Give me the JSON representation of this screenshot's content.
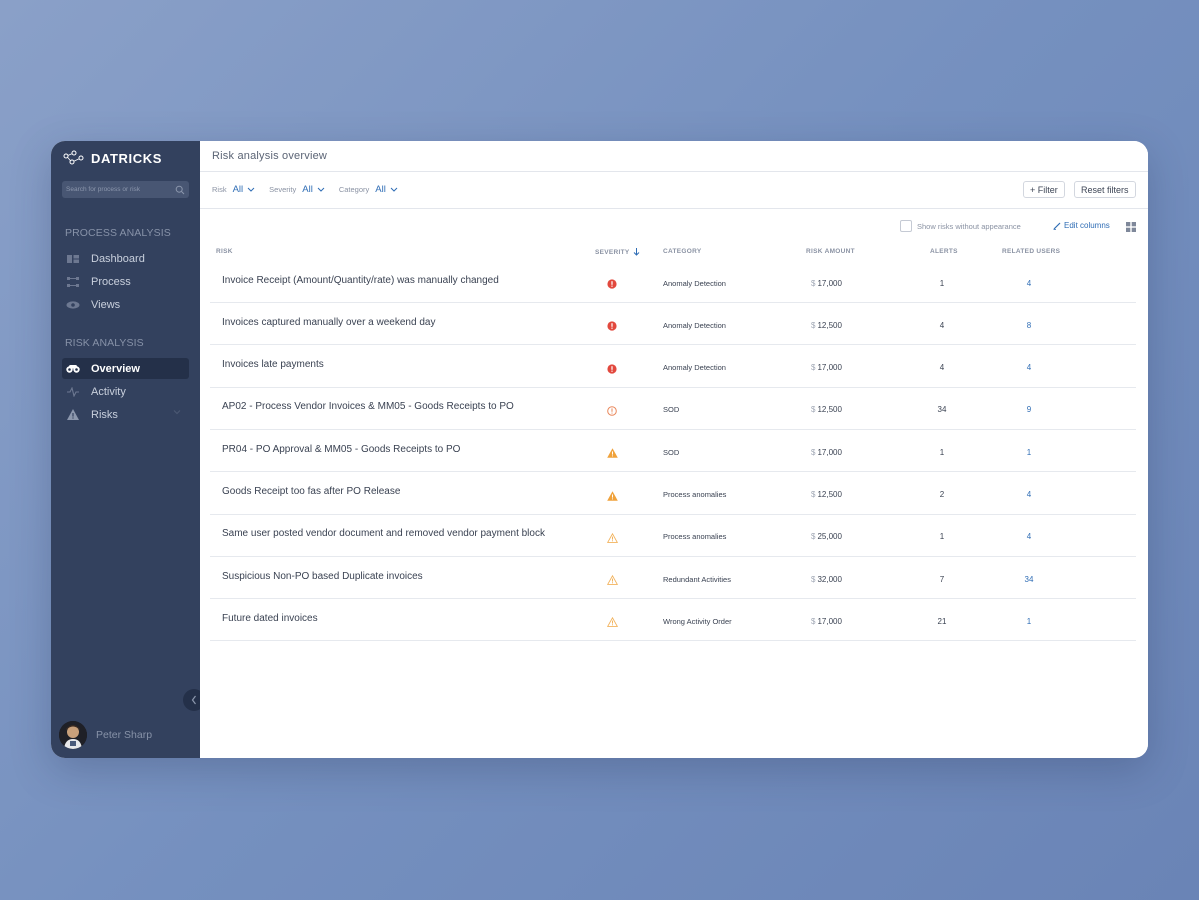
{
  "app": {
    "brand": "DATRICKS"
  },
  "sidebar": {
    "search_placeholder": "Search for process or risk",
    "sections": [
      {
        "title": "PROCESS ANALYSIS",
        "items": [
          {
            "label": "Dashboard",
            "icon": "dashboard-icon"
          },
          {
            "label": "Process",
            "icon": "process-icon"
          },
          {
            "label": "Views",
            "icon": "eye-icon"
          }
        ]
      },
      {
        "title": "RISK ANALYSIS",
        "items": [
          {
            "label": "Overview",
            "icon": "binoculars-icon",
            "active": true
          },
          {
            "label": "Activity",
            "icon": "activity-icon"
          },
          {
            "label": "Risks",
            "icon": "warning-icon",
            "expandable": true
          }
        ]
      }
    ],
    "user": {
      "name": "Peter Sharp"
    }
  },
  "main": {
    "title": "Risk analysis overview",
    "filters": [
      {
        "label": "Risk",
        "value": "All"
      },
      {
        "label": "Severity",
        "value": "All"
      },
      {
        "label": "Category",
        "value": "All"
      }
    ],
    "buttons": {
      "filter": "+  Filter",
      "reset": "Reset filters"
    },
    "show_without_appearance": "Show risks without appearance",
    "edit_columns": "Edit columns",
    "columns": {
      "risk": "RISK",
      "severity": "SEVERITY",
      "category": "CATEGORY",
      "amount": "RISK AMOUNT",
      "alerts": "ALERTS",
      "users": "RELATED USERS"
    },
    "currency": "$",
    "rows": [
      {
        "risk": "Invoice Receipt (Amount/Quantity/rate) was manually changed",
        "severity": "critical",
        "category": "Anomaly Detection",
        "amount": "17,000",
        "alerts": "1",
        "users": "4"
      },
      {
        "risk": "Invoices captured manually over a weekend day",
        "severity": "critical",
        "category": "Anomaly Detection",
        "amount": "12,500",
        "alerts": "4",
        "users": "8"
      },
      {
        "risk": "Invoices late payments",
        "severity": "critical",
        "category": "Anomaly Detection",
        "amount": "17,000",
        "alerts": "4",
        "users": "4"
      },
      {
        "risk": "AP02 - Process Vendor Invoices & MM05 - Goods Receipts to PO",
        "severity": "high",
        "category": "SOD",
        "amount": "12,500",
        "alerts": "34",
        "users": "9"
      },
      {
        "risk": "PR04 - PO Approval & MM05 - Goods Receipts to PO",
        "severity": "medium",
        "category": "SOD",
        "amount": "17,000",
        "alerts": "1",
        "users": "1"
      },
      {
        "risk": "Goods Receipt too fas after PO Release",
        "severity": "medium",
        "category": "Process anomalies",
        "amount": "12,500",
        "alerts": "2",
        "users": "4"
      },
      {
        "risk": "Same user posted vendor document and removed vendor payment block",
        "severity": "low",
        "category": "Process anomalies",
        "amount": "25,000",
        "alerts": "1",
        "users": "4"
      },
      {
        "risk": "Suspicious Non-PO based Duplicate invoices",
        "severity": "low",
        "category": "Redundant Activities",
        "amount": "32,000",
        "alerts": "7",
        "users": "34"
      },
      {
        "risk": "Future dated invoices",
        "severity": "low",
        "category": "Wrong Activity Order",
        "amount": "17,000",
        "alerts": "21",
        "users": "1"
      }
    ]
  },
  "colors": {
    "sidebar": "#33415e",
    "accent": "#2f6db5",
    "critical": "#e2483d",
    "warning": "#f0a23b"
  }
}
